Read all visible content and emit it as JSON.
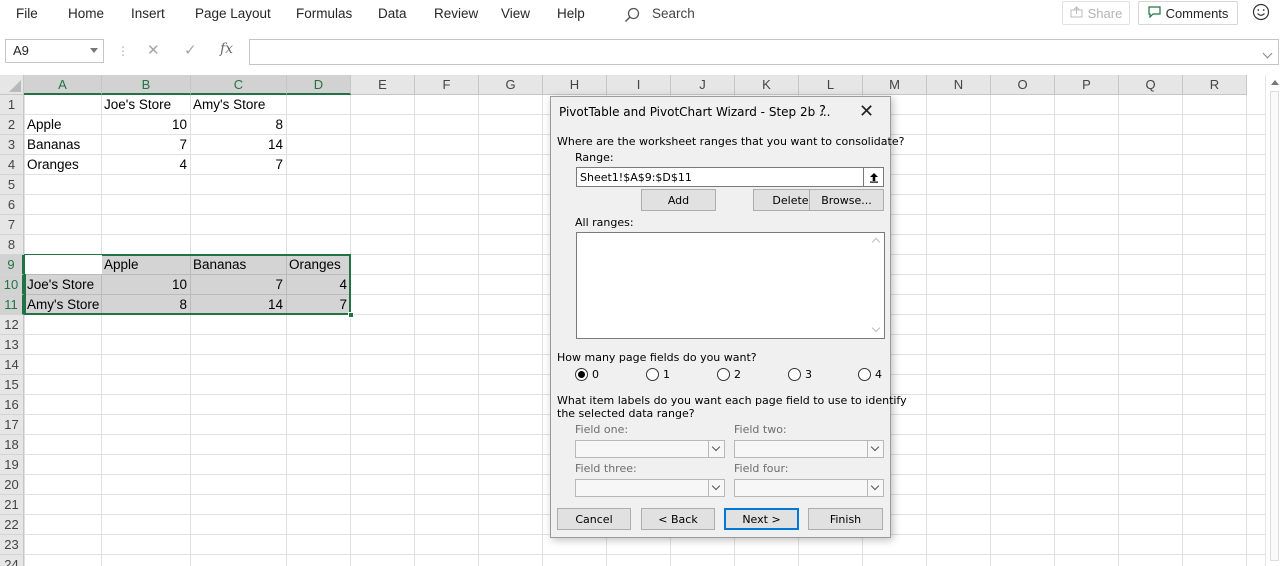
{
  "menu": {
    "items": [
      "File",
      "Home",
      "Insert",
      "Page Layout",
      "Formulas",
      "Data",
      "Review",
      "View",
      "Help"
    ],
    "search_label": "Search",
    "share_label": "Share",
    "comments_label": "Comments"
  },
  "formula_bar": {
    "name_box": "A9",
    "fx_label": "fx",
    "formula": ""
  },
  "columns": [
    "A",
    "B",
    "C",
    "D",
    "E",
    "F",
    "G",
    "H",
    "I",
    "J",
    "K",
    "L",
    "M",
    "N",
    "O",
    "P",
    "Q",
    "R"
  ],
  "rows": [
    "1",
    "2",
    "3",
    "4",
    "5",
    "6",
    "7",
    "8",
    "9",
    "10",
    "11",
    "12",
    "13",
    "14",
    "15",
    "16",
    "17",
    "18",
    "19",
    "20",
    "21",
    "22",
    "23",
    "24"
  ],
  "sheet": {
    "r1": {
      "b": "Joe's Store",
      "c": "Amy's Store"
    },
    "r2": {
      "a": "Apple",
      "b": "10",
      "c": "8"
    },
    "r3": {
      "a": "Bananas",
      "b": "7",
      "c": "14"
    },
    "r4": {
      "a": "Oranges",
      "b": "4",
      "c": "7"
    },
    "r9": {
      "b": "Apple",
      "c": "Bananas",
      "d": "Oranges"
    },
    "r10": {
      "a": "Joe's Store",
      "b": "10",
      "c": "7",
      "d": "4"
    },
    "r11": {
      "a": "Amy's Store",
      "b": "8",
      "c": "14",
      "d": "7"
    }
  },
  "dialog": {
    "title": "PivotTable and PivotChart Wizard - Step 2b ...",
    "help": "?",
    "close": "✕",
    "question": "Where are the worksheet ranges that you want to consolidate?",
    "range_label": "Range:",
    "range_value": "Sheet1!$A$9:$D$11",
    "add": "Add",
    "delete": "Delete",
    "browse": "Browse...",
    "all_ranges_label": "All ranges:",
    "page_fields_question": "How many page fields do you want?",
    "page_field_options": [
      "0",
      "1",
      "2",
      "3",
      "4"
    ],
    "page_field_selected": "0",
    "item_labels_question_1": "What item labels do you want each page field to use to identify",
    "item_labels_question_2": "the selected data range?",
    "field_one": "Field one:",
    "field_two": "Field two:",
    "field_three": "Field three:",
    "field_four": "Field four:",
    "cancel": "Cancel",
    "back": "< Back",
    "next": "Next >",
    "finish": "Finish"
  },
  "colors": {
    "accent": "#217346",
    "selection": "#217346",
    "default_button": "#0078d7"
  }
}
